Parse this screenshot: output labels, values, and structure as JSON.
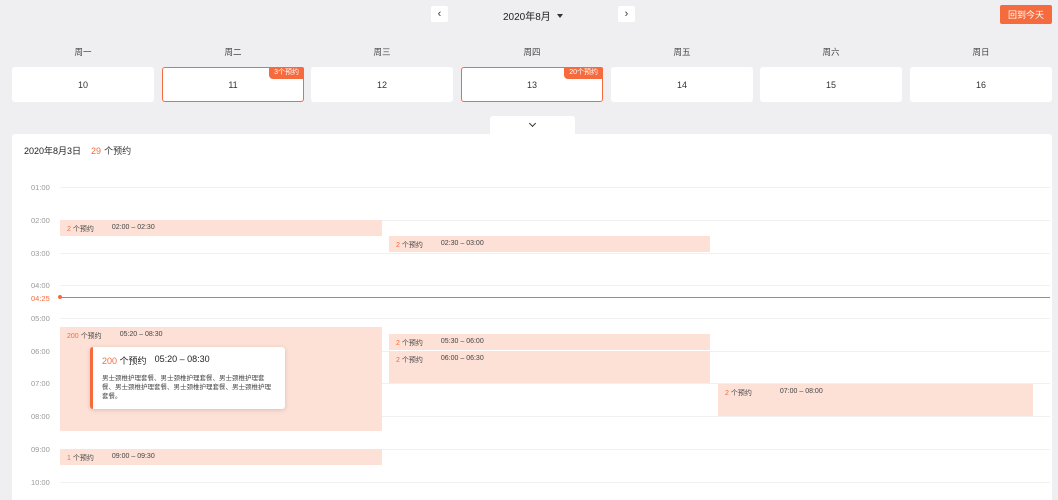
{
  "header": {
    "month": "2020年8月",
    "today_label": "回到今天"
  },
  "week": [
    {
      "weekday": "周一",
      "date": "10",
      "badge": ""
    },
    {
      "weekday": "周二",
      "date": "11",
      "badge": "3个预约"
    },
    {
      "weekday": "周三",
      "date": "12",
      "badge": ""
    },
    {
      "weekday": "周四",
      "date": "13",
      "badge": "20个预约"
    },
    {
      "weekday": "周五",
      "date": "14",
      "badge": ""
    },
    {
      "weekday": "周六",
      "date": "15",
      "badge": ""
    },
    {
      "weekday": "周日",
      "date": "16",
      "badge": ""
    }
  ],
  "schedule": {
    "date": "2020年8月3日",
    "count": "29",
    "count_label": "个预约",
    "times": [
      "01:00",
      "02:00",
      "03:00",
      "04:00",
      "05:00",
      "06:00",
      "07:00",
      "08:00",
      "09:00",
      "10:00"
    ],
    "now": "04:25",
    "unit": "个预约",
    "events": [
      {
        "count": "2",
        "time": "02:00 – 02:30"
      },
      {
        "count": "2",
        "time": "02:30 – 03:00"
      },
      {
        "count": "200",
        "time": "05:20 – 08:30"
      },
      {
        "count": "2",
        "time": "05:30 – 06:00"
      },
      {
        "count": "2",
        "time": "06:00 – 06:30"
      },
      {
        "count": "2",
        "time": "07:00 – 08:00"
      },
      {
        "count": "1",
        "time": "09:00 – 09:30"
      }
    ],
    "popover": {
      "count": "200",
      "unit": "个预约",
      "time": "05:20 – 08:30",
      "description": "男士颈椎护理套餐、男士颈椎护理套餐、男士颈椎护理套餐、男士颈椎护理套餐、男士颈椎护理套餐、男士颈椎护理套餐。"
    }
  }
}
